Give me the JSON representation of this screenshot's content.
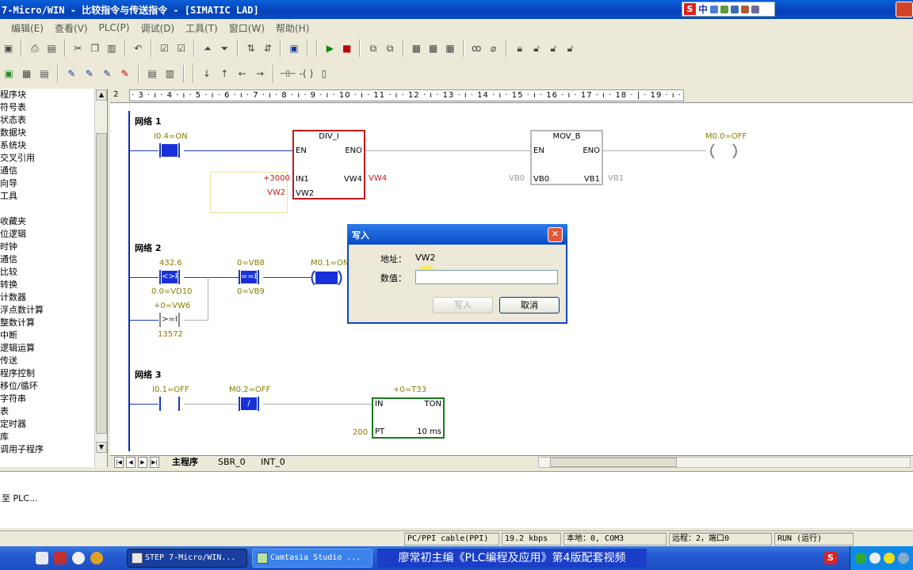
{
  "window": {
    "title": "7-Micro/WIN - 比较指令与传送指令 - [SIMATIC LAD]"
  },
  "menu": [
    "编辑(E)",
    "查看(V)",
    "PLC(P)",
    "调试(D)",
    "工具(T)",
    "窗口(W)",
    "帮助(H)"
  ],
  "tree": {
    "items": [
      "程序块",
      "符号表",
      "状态表",
      "数据块",
      "系统块",
      "交叉引用",
      "通信",
      "向导",
      "工具",
      "",
      "收藏夹",
      "位逻辑",
      "时钟",
      "通信",
      "比较",
      "转换",
      "计数器",
      "浮点数计算",
      "整数计算",
      "中断",
      "逻辑运算",
      "传送",
      "程序控制",
      "移位/循环",
      "字符串",
      "表",
      "定时器",
      "库",
      "调用子程序"
    ]
  },
  "ruler": {
    "first": "2",
    "marks": "· 3 · ı · 4 · ı · 5 · ı · 6 · ı · 7 · ı · 8 · ı · 9 · ı · 10 · ı · 11 · ı · 12 · ı · 13 · ı · 14 · ı · 15 · ı · 16 · ı · 17 · ı · 18 · | · 19 · ı · 20 ·"
  },
  "networks": {
    "n1": {
      "title": "网络 1",
      "contact_label": "I0.4=ON",
      "div_name": "DIV_I",
      "div_en": "EN",
      "div_eno": "ENO",
      "div_in1": "IN1",
      "div_in2": "VW2",
      "div_out": "VW4",
      "in1_value": "+3000",
      "in2_value": "VW2",
      "out_value": "VW4",
      "mov_name": "MOV_B",
      "mov_en": "EN",
      "mov_eno": "ENO",
      "mov_in": "VB0",
      "mov_out": "VB1",
      "mov_in_value": "VB0",
      "mov_out_value": "VB1",
      "coil_label": "M0.0=OFF"
    },
    "n2": {
      "title": "网络 2",
      "cmp1_top": "432.6",
      "cmp1_op": "<>R",
      "cmp1_bottom": "0.0=VD10",
      "cmp2_top": "0=VB8",
      "cmp2_op": "==B",
      "cmp2_bottom": "0=VB9",
      "cmp3_top": "+0=VW6",
      "cmp3_op": ">=I",
      "cmp3_bottom": "13572",
      "coil_label": "M0.1=ON"
    },
    "n3": {
      "title": "网络 3",
      "contact1_label": "I0.1=OFF",
      "contact2_label": "M0.2=OFF",
      "contact2_op": "/",
      "timer_label": "+0=T33",
      "timer_in": "IN",
      "timer_type": "TON",
      "timer_pt": "PT",
      "timer_res": "10 ms",
      "pt_value": "200"
    }
  },
  "dialog": {
    "title": "写入",
    "address_label": "地址：",
    "address_value": "VW2",
    "value_label": "数值：",
    "value_input": "",
    "write_button": "写入",
    "cancel_button": "取消"
  },
  "tabs": [
    "主程序",
    "SBR_0",
    "INT_0"
  ],
  "output": {
    "line": "至 PLC..."
  },
  "status": {
    "cable": "PC/PPI cable(PPI)",
    "rate": "19.2 kbps",
    "local": "本地：0, COM3",
    "remote": "远程：2，端口0",
    "mode": "RUN (运行)"
  },
  "taskbar": {
    "task1": "STEP 7-Micro/WIN...",
    "task2": "Camtasia Studio ...",
    "banner": "廖常初主编《PLC编程及应用》第4版配套视频"
  },
  "colors": {
    "rail": "#0a2ab0",
    "energized": "#1830d8",
    "box_red": "#c01818",
    "box_green": "#1a7a1a",
    "online_text": "#8a7a00"
  }
}
